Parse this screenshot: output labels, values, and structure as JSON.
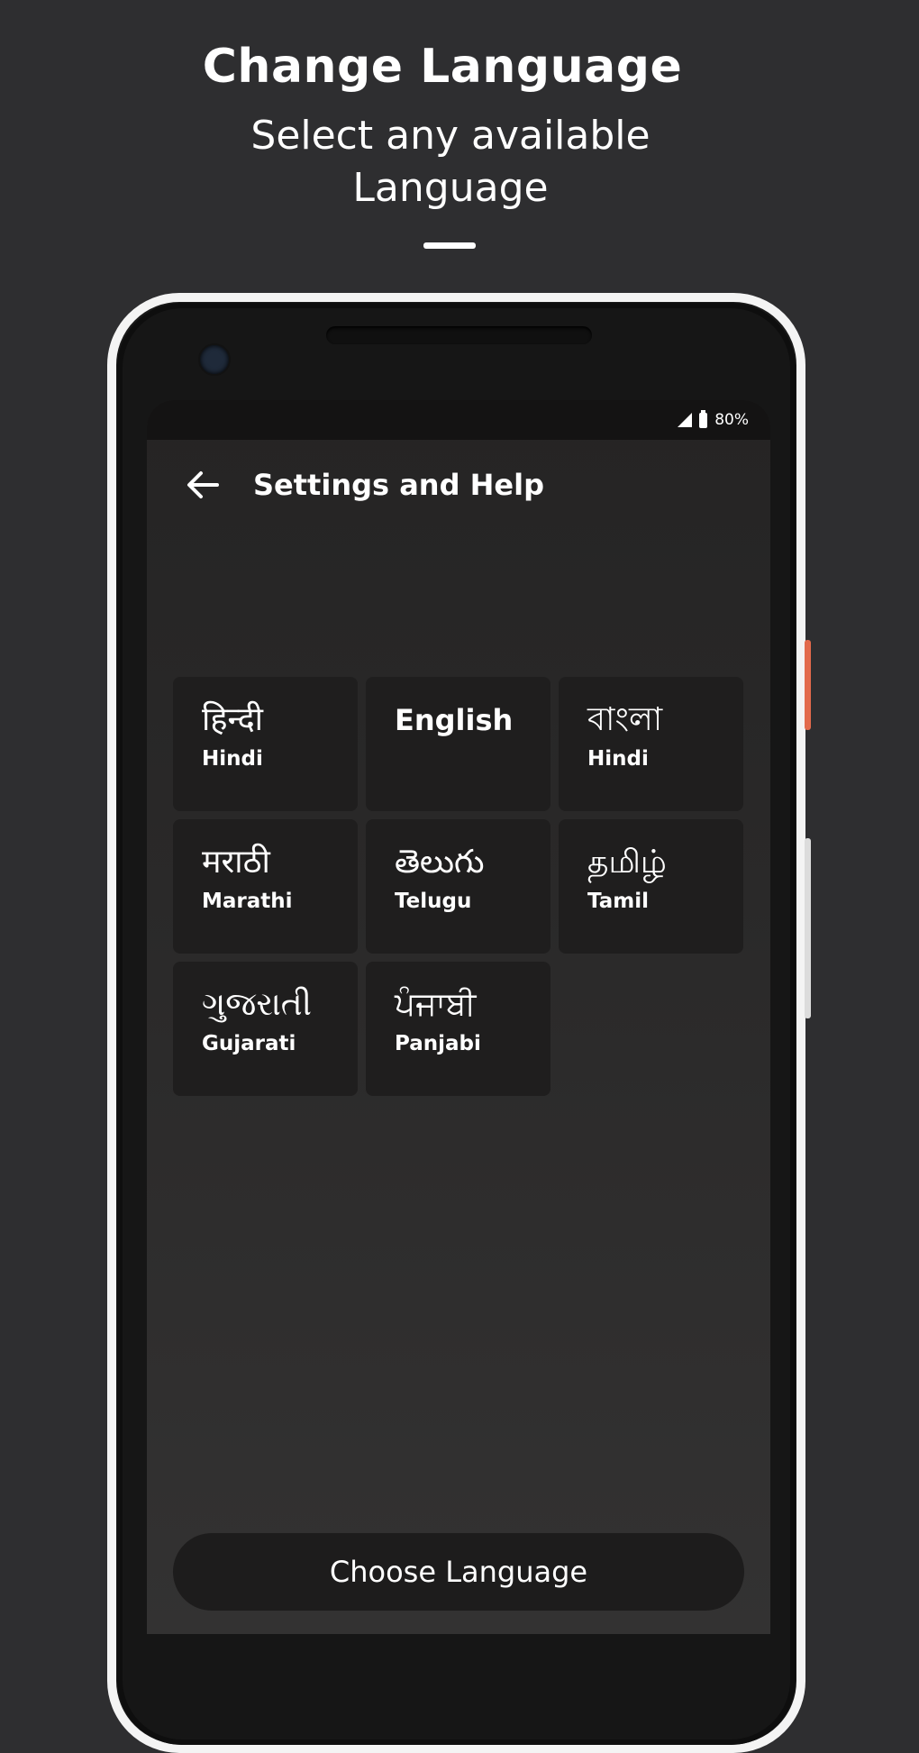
{
  "promo": {
    "title": "Change Language",
    "subtitle_line1": "Select any available",
    "subtitle_line2": "Language"
  },
  "status_bar": {
    "battery": "80%",
    "icons": [
      "signal-icon",
      "battery-icon"
    ]
  },
  "app_bar": {
    "back_icon": "arrow-left-icon",
    "title": "Settings and Help"
  },
  "languages": [
    {
      "native": "हिन्दी",
      "english": "Hindi"
    },
    {
      "native": "English",
      "english": ""
    },
    {
      "native": "বাংলা",
      "english": "Hindi"
    },
    {
      "native": "मराठी",
      "english": "Marathi"
    },
    {
      "native": "తెలుగు",
      "english": "Telugu"
    },
    {
      "native": "தமிழ்",
      "english": "Tamil"
    },
    {
      "native": "ગુજરાતી",
      "english": "Gujarati"
    },
    {
      "native": "ਪੰਜਾਬੀ",
      "english": "Panjabi"
    }
  ],
  "choose_button": {
    "label": "Choose Language"
  },
  "colors": {
    "background": "#2e2e30",
    "card": "#1f1e1e",
    "accent_side_button": "#e26a4c"
  }
}
